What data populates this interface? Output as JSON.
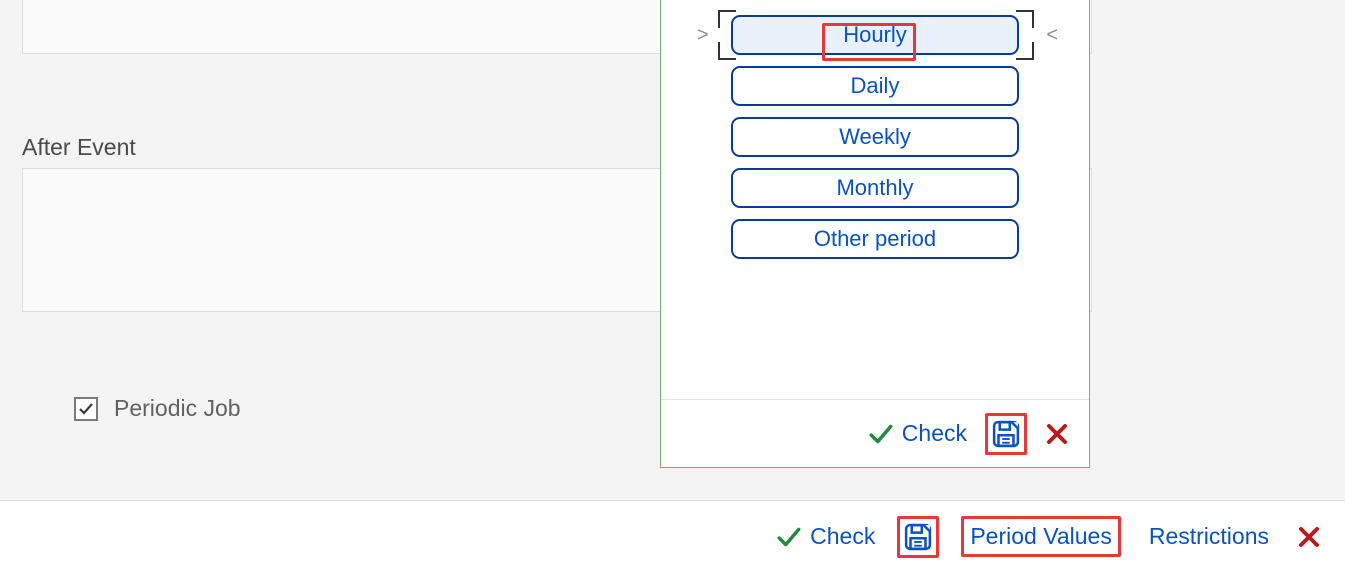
{
  "sections": {
    "after_event_label": "After Event"
  },
  "periodic": {
    "label": "Periodic Job",
    "checked": true
  },
  "period_options": [
    {
      "label": "Hourly",
      "selected": true
    },
    {
      "label": "Daily",
      "selected": false
    },
    {
      "label": "Weekly",
      "selected": false
    },
    {
      "label": "Monthly",
      "selected": false
    },
    {
      "label": "Other period",
      "selected": false
    }
  ],
  "popup_footer": {
    "check_label": "Check"
  },
  "bottom_bar": {
    "check_label": "Check",
    "period_values_label": "Period Values",
    "restrictions_label": "Restrictions"
  },
  "colors": {
    "accent_blue": "#0a53be",
    "border_blue": "#0a3d91",
    "popup_border": "#6fb36f",
    "highlight_red": "#e63838",
    "close_red": "#b71c1c",
    "check_green": "#1f8a3b"
  }
}
